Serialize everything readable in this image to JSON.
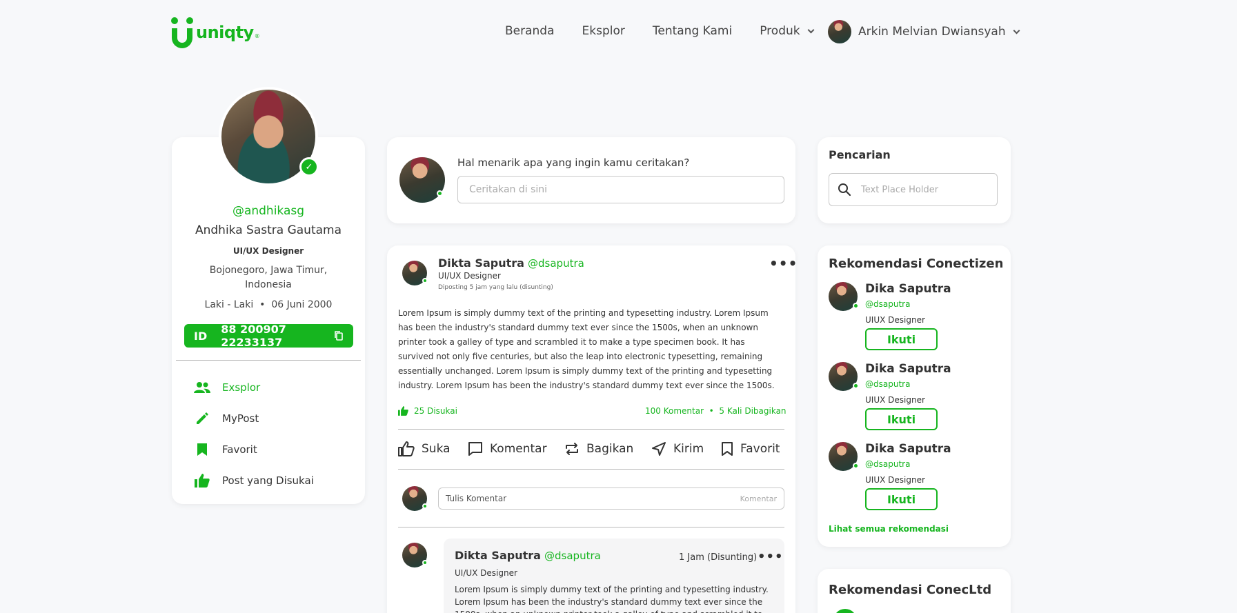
{
  "brand": {
    "name": "uniqty",
    "reg": "®",
    "color": "#16b51f"
  },
  "nav": {
    "items": [
      "Beranda",
      "Eksplor",
      "Tentang Kami",
      "Produk"
    ],
    "user_name": "Arkin Melvian Dwiansyah"
  },
  "profile": {
    "username": "@andhikasg",
    "full_name": "Andhika Sastra Gautama",
    "role": "UI/UX Designer",
    "location_line1": "Bojonegoro, Jawa Timur,",
    "location_line2": "Indonesia",
    "gender": "Laki - Laki",
    "birthdate": "06 Juni 2000",
    "id_label": "ID",
    "id_number": "88 200907 22233137",
    "menu": [
      {
        "label": "Exsplor",
        "icon": "people-icon",
        "active": true
      },
      {
        "label": "MyPost",
        "icon": "pencil-icon",
        "active": false
      },
      {
        "label": "Favorit",
        "icon": "bookmark-icon",
        "active": false
      },
      {
        "label": "Post yang Disukai",
        "icon": "thumbs-up-icon",
        "active": false
      }
    ]
  },
  "composer": {
    "prompt": "Hal menarik apa yang ingin kamu ceritakan?",
    "placeholder": "Ceritakan di sini"
  },
  "post": {
    "author": "Dikta Saputra",
    "handle": "@dsaputra",
    "role": "UI/UX Designer",
    "meta": "Diposting 5 jam yang lalu (disunting)",
    "body": "Lorem Ipsum is simply dummy text of the printing and typesetting industry. Lorem Ipsum has been the industry's standard dummy text ever since the 1500s, when an unknown printer took a galley of type and scrambled it to make a type specimen book. It has survived not only five centuries, but also the leap into electronic typesetting, remaining essentially unchanged. Lorem Ipsum is simply dummy text of the printing and typesetting industry. Lorem Ipsum has been the industry's standard dummy text ever since the 1500s.",
    "likes": "25 Disukai",
    "comments": "100 Komentar",
    "shares": "5 Kali Dibagikan",
    "actions": {
      "like": "Suka",
      "comment": "Komentar",
      "share": "Bagikan",
      "send": "Kirim",
      "favorite": "Favorit"
    },
    "comment_placeholder": "Tulis Komentar",
    "comment_button": "Komentar"
  },
  "comment": {
    "author": "Dikta Saputra",
    "handle": "@dsaputra",
    "time": "1 Jam (Disunting)",
    "role": "UI/UX Designer",
    "body": "Lorem Ipsum is simply dummy text of the printing and typesetting industry. Lorem Ipsum has been the industry's standard dummy text ever since the 1500s, when an unknown printer took a galley of type and scrambled it to make a type specimen book."
  },
  "search": {
    "title": "Pencarian",
    "placeholder": "Text Place Holder"
  },
  "recommendations": {
    "title": "Rekomendasi Conectizen",
    "items": [
      {
        "name": "Dika Saputra",
        "handle": "@dsaputra",
        "role": "UIUX Designer",
        "button": "Ikuti"
      },
      {
        "name": "Dika Saputra",
        "handle": "@dsaputra",
        "role": "UIUX Designer",
        "button": "Ikuti"
      },
      {
        "name": "Dika Saputra",
        "handle": "@dsaputra",
        "role": "UIUX Designer",
        "button": "Ikuti"
      }
    ],
    "see_all": "Lihat semua rekomendasi"
  },
  "ltd": {
    "title": "Rekomendasi ConecLtd"
  }
}
